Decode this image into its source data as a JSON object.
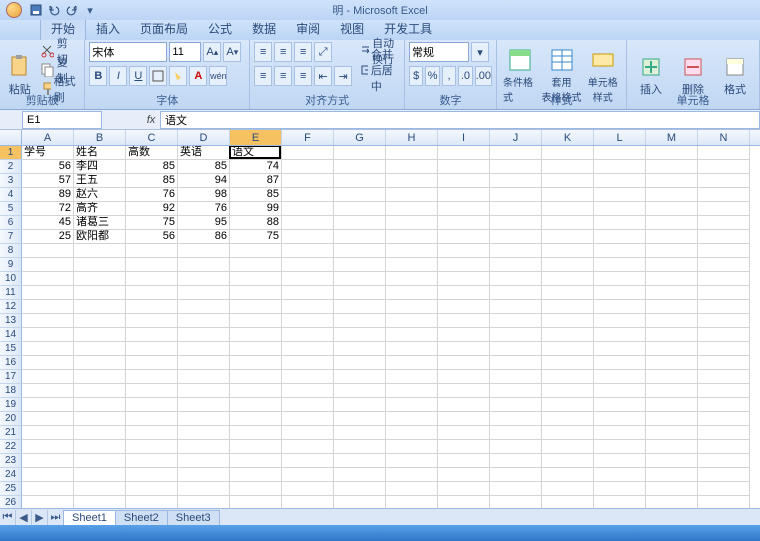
{
  "app": {
    "title": "明 - Microsoft Excel"
  },
  "tabs": {
    "home": "开始",
    "insert": "插入",
    "layout": "页面布局",
    "formulas": "公式",
    "data": "数据",
    "review": "审阅",
    "view": "视图",
    "dev": "开发工具"
  },
  "ribbon": {
    "clipboard": {
      "label": "剪贴板",
      "paste": "粘贴",
      "cut": "剪切",
      "copy": "复制",
      "painter": "格式刷"
    },
    "font": {
      "label": "字体",
      "name": "宋体",
      "size": "11"
    },
    "align": {
      "label": "对齐方式",
      "wrap": "自动换行",
      "merge": "合并后居中"
    },
    "number": {
      "label": "数字",
      "format": "常规"
    },
    "styles": {
      "label": "样式",
      "cond": "条件格式",
      "table": "套用\n表格格式",
      "cell": "单元格\n样式"
    },
    "cells": {
      "label": "单元格",
      "insert": "插入",
      "delete": "删除",
      "format": "格式"
    }
  },
  "formula_bar": {
    "name_box": "E1",
    "value": "语文"
  },
  "columns": [
    "A",
    "B",
    "C",
    "D",
    "E",
    "F",
    "G",
    "H",
    "I",
    "J",
    "K",
    "L",
    "M",
    "N"
  ],
  "active_col": "E",
  "active_row": 1,
  "data_rows": [
    {
      "r": 1,
      "A": "学号",
      "B": "姓名",
      "C": "高数",
      "D": "英语",
      "E": "语文"
    },
    {
      "r": 2,
      "A": "56",
      "B": "李四",
      "C": "85",
      "D": "85",
      "E": "74"
    },
    {
      "r": 3,
      "A": "57",
      "B": "王五",
      "C": "85",
      "D": "94",
      "E": "87"
    },
    {
      "r": 4,
      "A": "89",
      "B": "赵六",
      "C": "76",
      "D": "98",
      "E": "85"
    },
    {
      "r": 5,
      "A": "72",
      "B": "高齐",
      "C": "92",
      "D": "76",
      "E": "99"
    },
    {
      "r": 6,
      "A": "45",
      "B": "诸葛三",
      "C": "75",
      "D": "95",
      "E": "88"
    },
    {
      "r": 7,
      "A": "25",
      "B": "欧阳都",
      "C": "56",
      "D": "86",
      "E": "75"
    }
  ],
  "total_rows": 27,
  "sheets": {
    "s1": "Sheet1",
    "s2": "Sheet2",
    "s3": "Sheet3"
  }
}
